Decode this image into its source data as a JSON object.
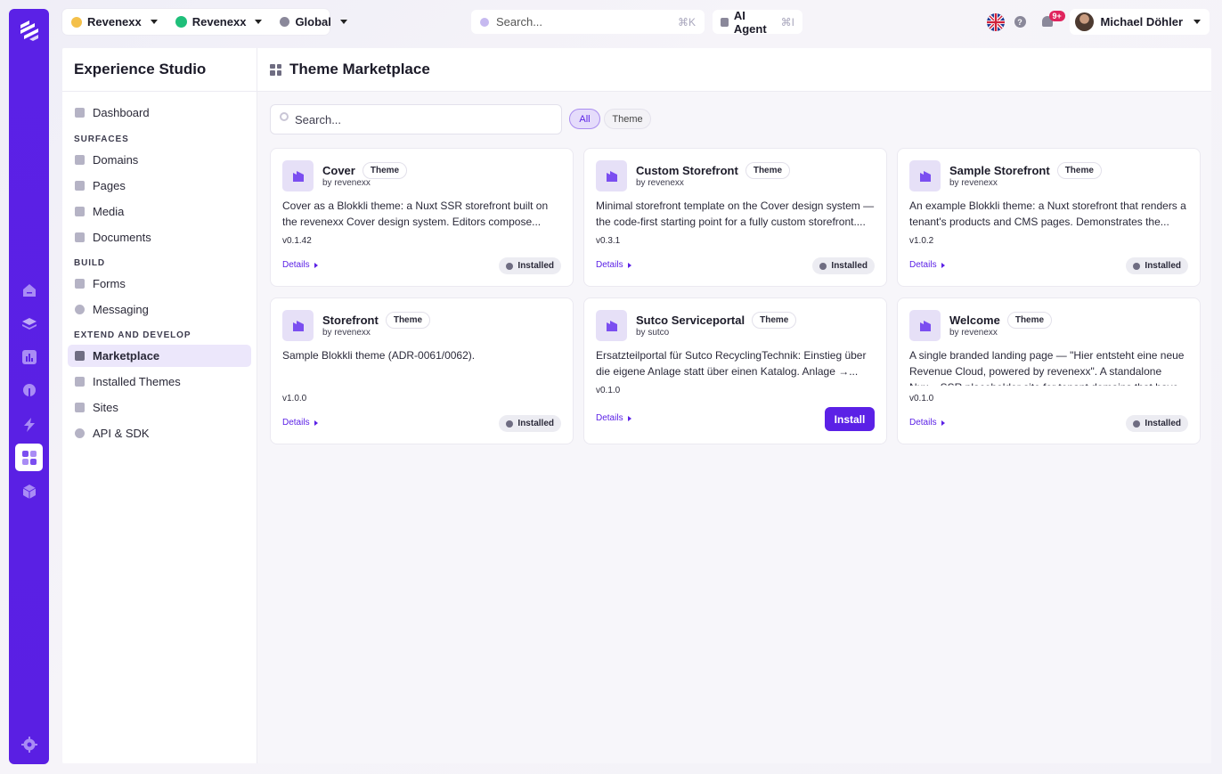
{
  "topbar": {
    "org_select": "Revenexx",
    "brand_select": "Revenexx",
    "region_select": "Global",
    "search_placeholder": "Search...",
    "search_shortcut": "⌘K",
    "ai_agent_label": "AI Agent",
    "ai_agent_shortcut": "⌘I",
    "notification_badge": "9+",
    "user_name": "Michael Döhler"
  },
  "sidebar": {
    "title": "Experience Studio",
    "dashboard": "Dashboard",
    "section_surfaces": "SURFACES",
    "domains": "Domains",
    "pages": "Pages",
    "media": "Media",
    "documents": "Documents",
    "section_build": "BUILD",
    "forms": "Forms",
    "messaging": "Messaging",
    "section_extend": "EXTEND AND DEVELOP",
    "marketplace": "Marketplace",
    "installed_themes": "Installed Themes",
    "sites": "Sites",
    "api_sdk": "API & SDK"
  },
  "main": {
    "title": "Theme Marketplace",
    "search_placeholder": "Search...",
    "filter_all": "All",
    "filter_theme": "Theme"
  },
  "cards": [
    {
      "name": "Cover",
      "tag": "Theme",
      "by": "by revenexx",
      "desc": "Cover as a Blokkli theme: a Nuxt SSR storefront built on the revenexx Cover design system. Editors compose...",
      "version": "v0.1.42",
      "details": "Details",
      "status": "Installed"
    },
    {
      "name": "Custom Storefront",
      "tag": "Theme",
      "by": "by revenexx",
      "desc": "Minimal storefront template on the Cover design system — the code-first starting point for a fully custom storefront....",
      "version": "v0.3.1",
      "details": "Details",
      "status": "Installed"
    },
    {
      "name": "Sample Storefront",
      "tag": "Theme",
      "by": "by revenexx",
      "desc": "An example Blokkli theme: a Nuxt storefront that renders a tenant's products and CMS pages. Demonstrates the...",
      "version": "v1.0.2",
      "details": "Details",
      "status": "Installed"
    },
    {
      "name": "Storefront",
      "tag": "Theme",
      "by": "by revenexx",
      "desc": "Sample Blokkli theme (ADR-0061/0062).",
      "version": "v1.0.0",
      "details": "Details",
      "status": "Installed"
    },
    {
      "name": "Sutco Serviceportal",
      "tag": "Theme",
      "by": "by sutco",
      "desc": "Ersatzteilportal für Sutco RecyclingTechnik: Einstieg über die eigene Anlage statt über einen Katalog. Anlage →...",
      "version": "v0.1.0",
      "details": "Details",
      "status": "Install"
    },
    {
      "name": "Welcome",
      "tag": "Theme",
      "by": "by revenexx",
      "desc": "A single branded landing page — \"Hier entsteht eine neue Revenue Cloud, powered by revenexx\". A standalone Nux... SSR placeholder site for tenant domains that have no",
      "version": "v0.1.0",
      "details": "Details",
      "status": "Installed"
    }
  ],
  "colors": {
    "accent": "#5b21e6",
    "rail": "#5b21e6"
  }
}
